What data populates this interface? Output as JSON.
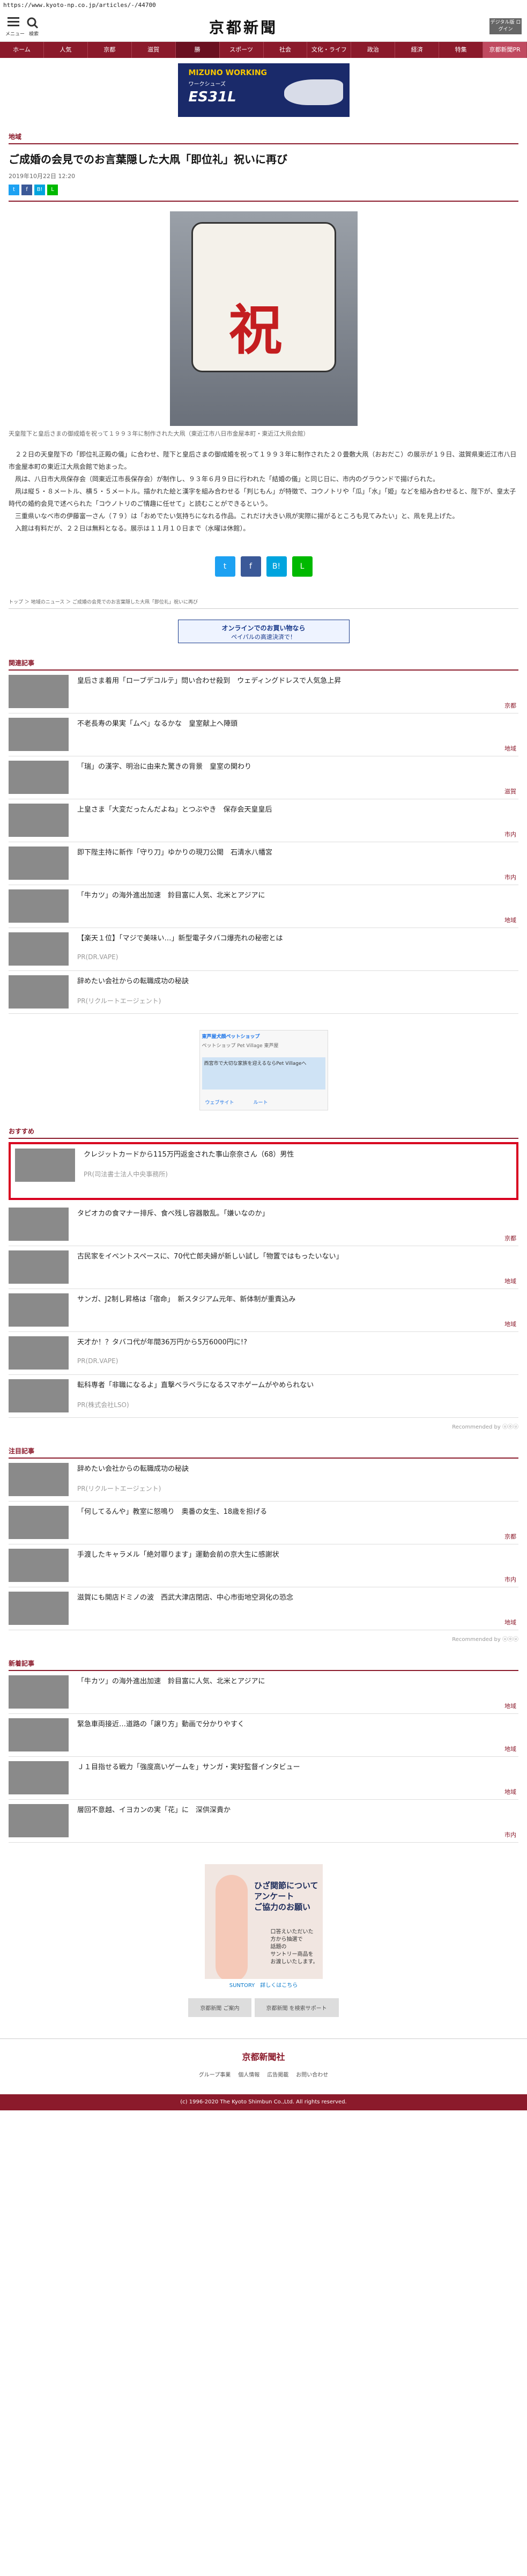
{
  "url": "https://www.kyoto-np.co.jp/articles/-/44700",
  "header": {
    "menu_label": "メニュー",
    "search_label": "検索",
    "logo": "京都新聞",
    "digital": "デジタル版 ログイン"
  },
  "nav": [
    "ホーム",
    "人気",
    "京都",
    "滋賀",
    "勝",
    "スポーツ",
    "社会",
    "文化・ライフ",
    "政治",
    "経済",
    "特集",
    "京都新聞PR"
  ],
  "ad1": {
    "brand": "MIZUNO WORKING",
    "text": "ワークシューズ",
    "name": "ES31L"
  },
  "article": {
    "category": "地域",
    "title": "ご成婚の会見でのお言葉隠した大凧「即位礼」祝いに再び",
    "date": "2019年10月22日 12:20",
    "caption": "天皇陛下と皇后さまの御成婚を祝って１９９３年に制作された大凧（東近江市八日市金屋本町・東近江大凧会館）",
    "paras": [
      "２２日の天皇陛下の「即位礼正殿の儀」に合わせ、陛下と皇后さまの御成婚を祝って１９９３年に制作された２０畳敷大凧（おおだこ）の展示が１９日、滋賀県東近江市八日市金屋本町の東近江大凧会館で始まった。",
      "凧は、八日市大凧保存会（岡東近江市長保存会）が制作し、９３年６月９日に行われた「結婚の儀」と同じ日に、市内のグラウンドで揚げられた。",
      "凧は縦５・８メートル、横５・５メートル。描かれた絵と漢字を組み合わせる「判じもん」が特徴で、コウノトリや「瓜」「水」「姫」などを組み合わせると、陛下が、皇太子時代の婚約会見で述べられた「コウノトリのご情趣に任せて」と読むことができるという。",
      "三重県いなべ市の伊藤富一さん（７９）は「おめでたい気持ちになれる作品。これだけ大きい凧が実際に揚がるところも見てみたい」と、凧を見上げた。",
      "入館は有料だが、２２日は無料となる。展示は１１月１０日まで（水曜は休館）。"
    ]
  },
  "breadcrumb": "トップ ＞ 地域のニュース ＞ ご成婚の会見でのお言葉隠した大凧「即位礼」祝いに再び",
  "ad2": {
    "line1": "オンラインでのお買い物なら",
    "line2": "ペイパルの高速決済で！"
  },
  "related": {
    "title": "関連記事",
    "items": [
      {
        "title": "皇后さま着用「ローブデコルテ」問い合わせ殺到　ウェディングドレスで人気急上昇",
        "src": "京都"
      },
      {
        "title": "不老長寿の果実「ムベ」なるかな　皇室献上へ陣頭",
        "src": "地域"
      },
      {
        "title": "「瑞」の漢字、明治に由来た驚きの背景　皇室の関わり",
        "src": "滋賀"
      },
      {
        "title": "上皇さま「大変だったんだよね」とつぶやき　保存会天皇皇后",
        "src": "市内"
      },
      {
        "title": "即下陛主持に新作「守り刀」ゆかりの現刀公開　石清水八幡宮",
        "src": "市内"
      },
      {
        "title": "「牛カツ」の海外進出加速　鈴目富に人気、北米とアジアに",
        "src": "地域"
      },
      {
        "title": "【楽天１位】「マジで美味い…」新型電子タバコ爆売れの秘密とは",
        "pr": "PR(DR.VAPE)"
      },
      {
        "title": "辞めたい会社からの転職成功の秘訣",
        "pr": "PR(リクルートエージェント)"
      }
    ]
  },
  "map_ad": {
    "head": "東芦屋犬顔ペットショップ",
    "sub": "ペットショップ Pet Village 東芦屋",
    "map_text": "西宮市で大切な家族を迎えるならPet Villageへ",
    "b1": "ウェブサイト",
    "b2": "ルート"
  },
  "recommend": {
    "title": "おすすめ",
    "items": [
      {
        "title": "クレジットカードから115万円返金された事山奈奈さん（68）男性",
        "pr": "PR(司法書士法人中央事務所)"
      },
      {
        "title": "タピオカの食マナー排斥、食べ残し容器散乱。「嫌いなのか」",
        "src": "京都"
      },
      {
        "title": "古民家をイベントスペースに、70代亡郎夫婦が新しい試し「物置ではもったいない」",
        "src": "地域"
      },
      {
        "title": "サンガ、J2制し昇格は「宿命」　新スタジアム元年、新体制が重責込み",
        "src": "地域"
      },
      {
        "title": "天才か！？タバコ代が年間36万円から5万6000円に!?",
        "pr": "PR(DR.VAPE)"
      },
      {
        "title": "転科専者「非職になるよ」直撃ベラベラになるスマホゲームがやめられない",
        "pr": "PR(株式会社LSO)"
      }
    ],
    "by": "Recommended by  ⓤⓞⓤ"
  },
  "attention": {
    "title": "注目記事",
    "items": [
      {
        "title": "辞めたい会社からの転職成功の秘訣",
        "pr": "PR(リクルートエージェント)"
      },
      {
        "title": "「何してるんや」教室に怒鳴り　奥番の女生、18歳を担げる",
        "src": "京都"
      },
      {
        "title": "手渡したキャラメル「絶対罪ります」運動会前の京大生に感謝状",
        "src": "市内"
      },
      {
        "title": "滋賀にも開店ドミノの波　西武大津店閉店、中心市街地空洞化の恐念",
        "src": "地域"
      }
    ],
    "by": "Recommended by  ⓤⓞⓤ"
  },
  "new": {
    "title": "新着記事",
    "items": [
      {
        "title": "「牛カツ」の海外進出加速　鈴目富に人気、北米とアジアに",
        "src": "地域"
      },
      {
        "title": "緊急車両接近…道路の「譲り方」動画で分かりやすく",
        "src": "地域"
      },
      {
        "title": "Ｊ１目指せる戦力「強度高いゲームを」サンガ・実好監督インタビュー",
        "src": "地域"
      },
      {
        "title": "層回不意越、イヨカンの実「花」に　深供深貴か",
        "src": "市内"
      }
    ]
  },
  "ad3": {
    "title": "ひざ関節について\nアンケート\nご協力のお願い",
    "desc": "口答えいただいた\n方から抽選で\n話題の\nサントリー商品を\nお渡しいたします。",
    "foot": "SUNTORY　詳しくはこちら"
  },
  "footer_btns": [
    "京都新聞 ご案内",
    "京都新聞 を検索サポート"
  ],
  "footer_logo": "京都新聞社",
  "footer_links": [
    "グループ事業",
    "個人情報",
    "広告掲載",
    "お問い合わせ"
  ],
  "copyright": "(c) 1996-2020 The Kyoto Shimbun Co.,Ltd. All rights reserved."
}
